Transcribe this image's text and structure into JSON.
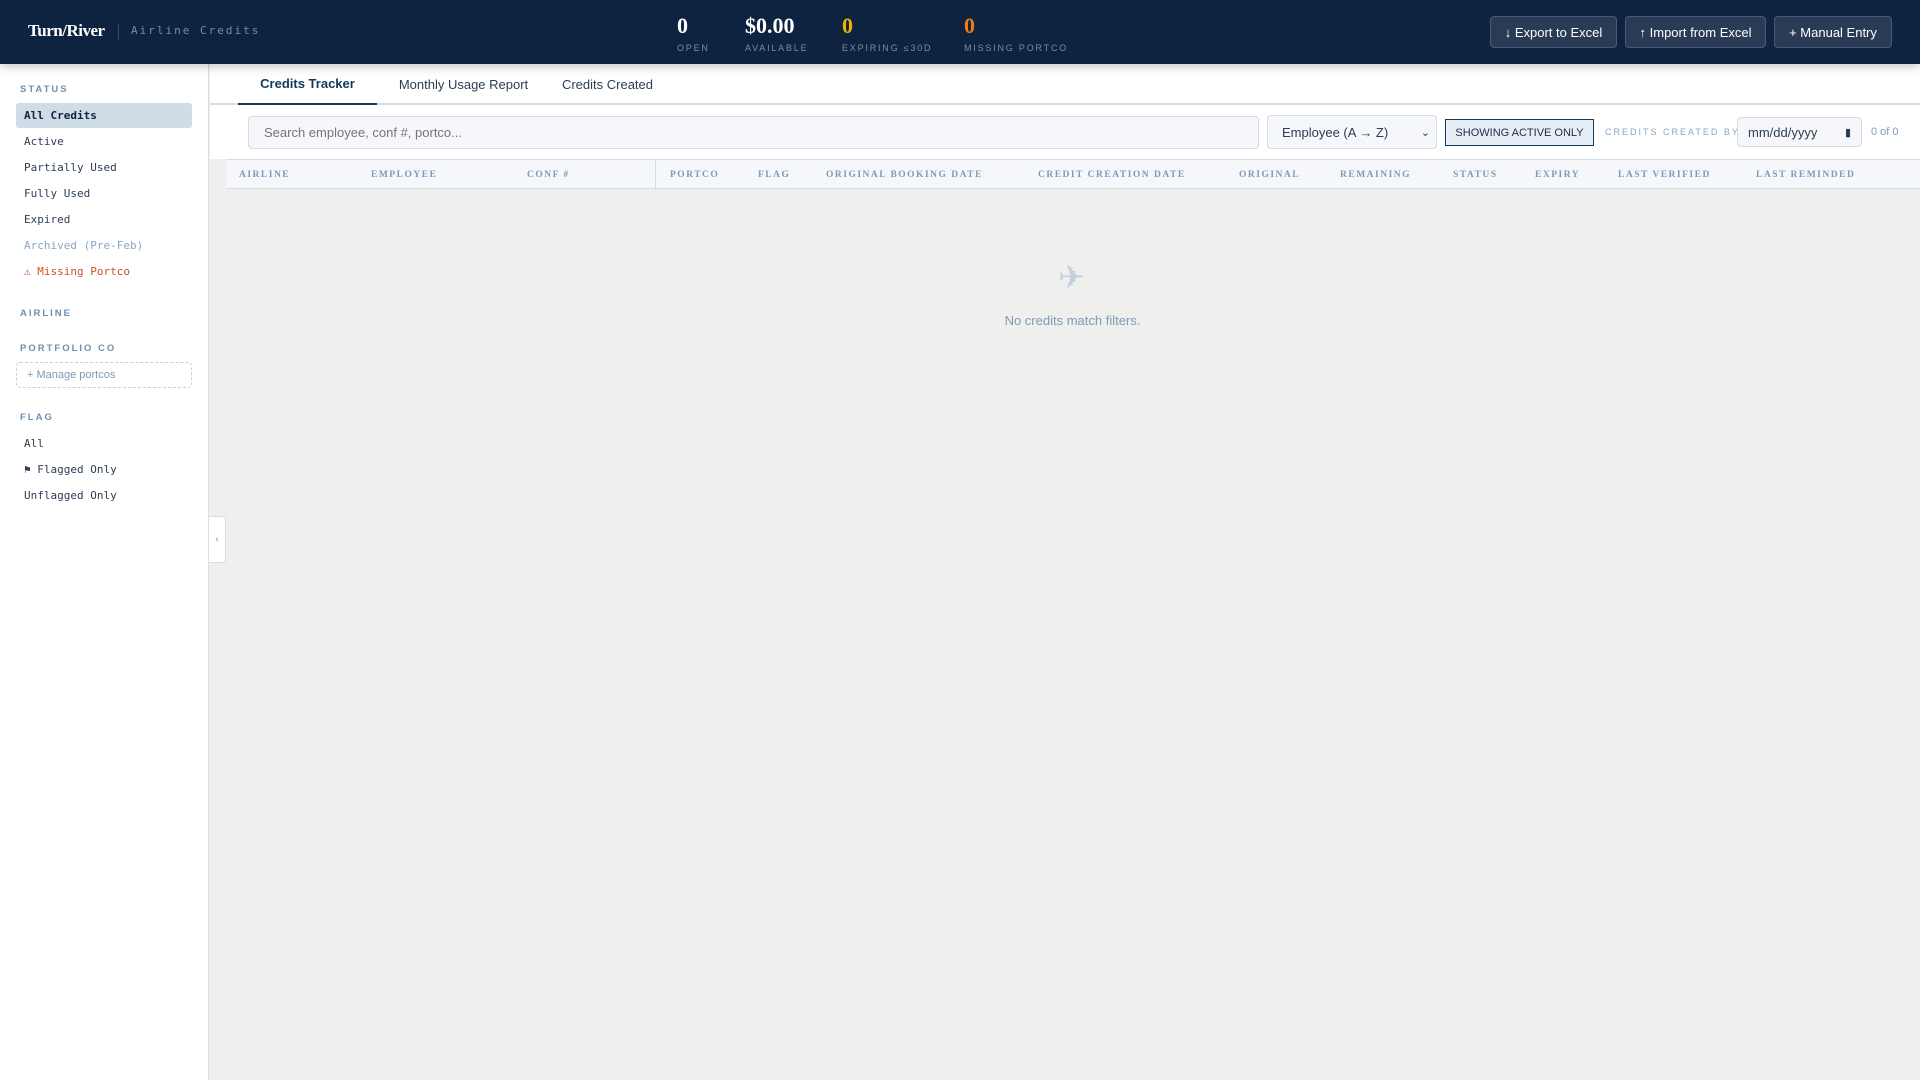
{
  "header": {
    "brand": "Turn/River",
    "subtitle": "Airline Credits",
    "stats": [
      {
        "value": "0",
        "label": "OPEN",
        "color": "#ffffff"
      },
      {
        "value": "$0.00",
        "label": "AVAILABLE",
        "color": "#ffffff"
      },
      {
        "value": "0",
        "label": "EXPIRING ≤30D",
        "color": "#f0b400"
      },
      {
        "value": "0",
        "label": "MISSING PORTCO",
        "color": "#f07a1a"
      }
    ],
    "buttons": {
      "export": "↓ Export to Excel",
      "import": "↑ Import from Excel",
      "manual": "+ Manual Entry"
    }
  },
  "sidebar": {
    "status_title": "STATUS",
    "status_items": [
      "All Credits",
      "Active",
      "Partially Used",
      "Fully Used",
      "Expired",
      "Archived (Pre-Feb)",
      "⚠ Missing Portco"
    ],
    "airline_title": "AIRLINE",
    "portfolio_title": "PORTFOLIO CO",
    "manage_portcos": "+ Manage portcos",
    "flag_title": "FLAG",
    "flag_items": [
      "All",
      "⚑ Flagged Only",
      "Unflagged Only"
    ],
    "collapse": "‹"
  },
  "tabs": [
    "Credits Tracker",
    "Monthly Usage Report",
    "Credits Created"
  ],
  "toolbar": {
    "search_placeholder": "Search employee, conf #, portco...",
    "sort": "Employee (A → Z)",
    "active_toggle": "SHOWING ACTIVE ONLY",
    "created_by_label": "CREDITS CREATED BY",
    "date_placeholder": "mm/dd/yyyy",
    "count": "0 of 0"
  },
  "table": {
    "columns": [
      "AIRLINE",
      "EMPLOYEE",
      "CONF #",
      "PORTCO",
      "FLAG",
      "ORIGINAL BOOKING DATE",
      "CREDIT CREATION DATE",
      "ORIGINAL",
      "REMAINING",
      "STATUS",
      "EXPIRY",
      "LAST VERIFIED",
      "LAST REMINDED"
    ],
    "empty_icon": "✈",
    "empty_text": "No credits match filters."
  }
}
